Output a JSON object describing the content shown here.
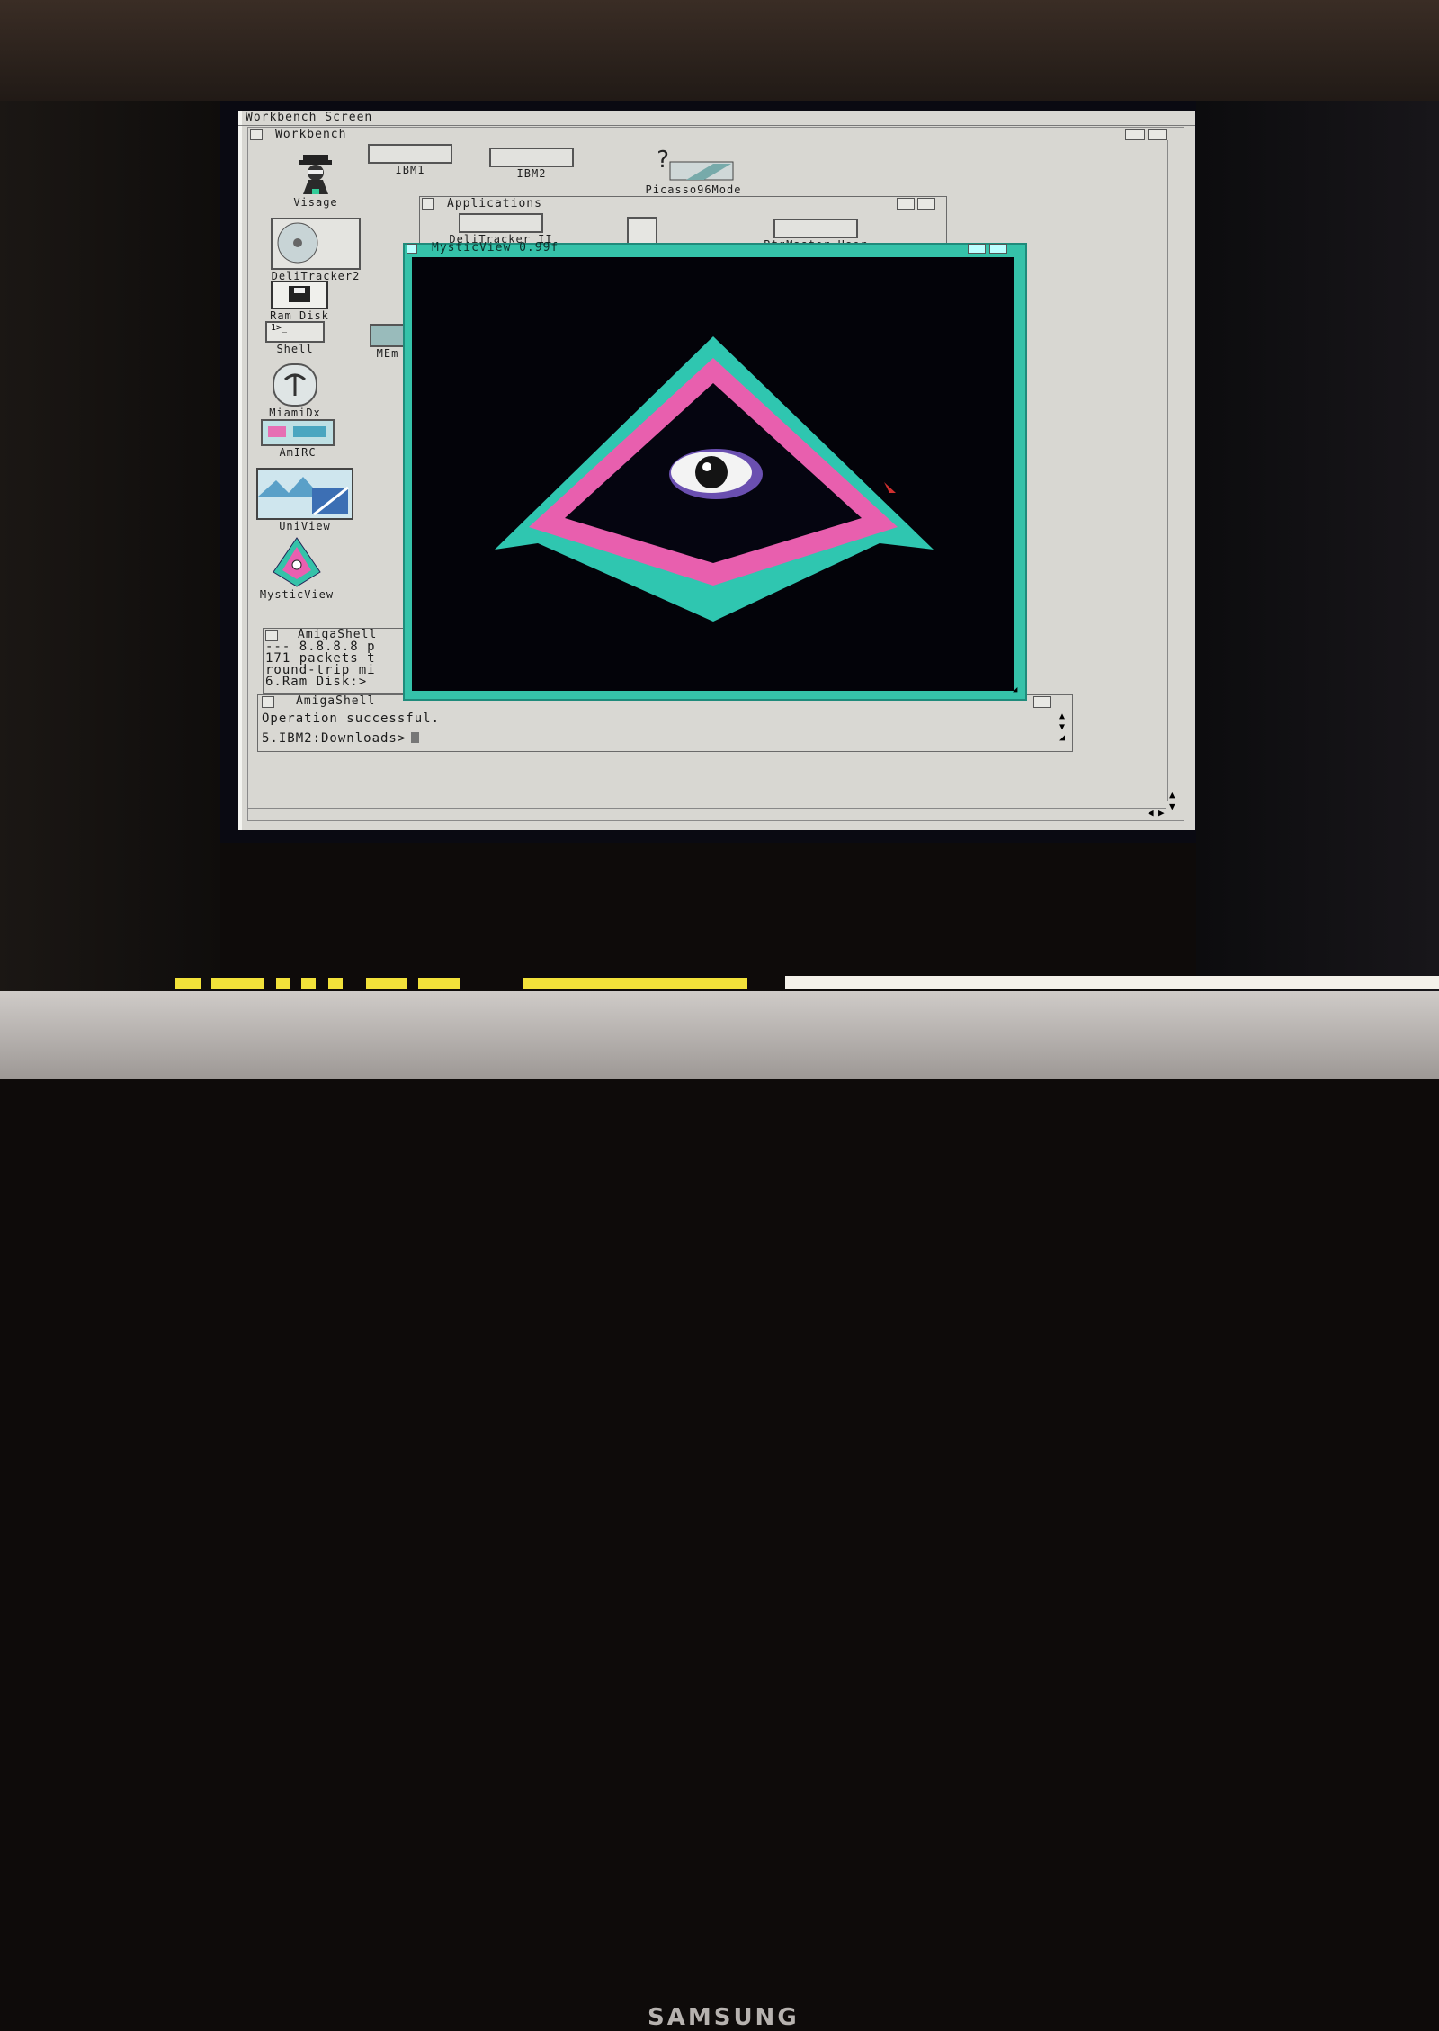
{
  "monitor": {
    "brand": "SAMSUNG"
  },
  "screen_title": "Workbench Screen",
  "workbench": {
    "title": "Workbench",
    "icons": [
      {
        "label": "Visage",
        "icon": "visage-icon"
      },
      {
        "label": "IBM1",
        "icon": "drive-icon"
      },
      {
        "label": "IBM2",
        "icon": "drive-icon"
      },
      {
        "label": "Picasso96Mode",
        "icon": "picasso-icon"
      },
      {
        "label": "DeliTracker2",
        "icon": "cd-icon"
      },
      {
        "label": "Ram Disk",
        "icon": "ram-disk-icon"
      },
      {
        "label": "Shell",
        "icon": "shell-icon"
      },
      {
        "label": "MEm",
        "icon": "mem-icon"
      },
      {
        "label": "MiamiDx",
        "icon": "miami-icon"
      },
      {
        "label": "AmIRC",
        "icon": "amirc-icon"
      },
      {
        "label": "UniView",
        "icon": "uniview-icon"
      },
      {
        "label": "MysticView",
        "icon": "mysticview-icon"
      }
    ]
  },
  "applications": {
    "title": "Applications",
    "icons": [
      {
        "label": "DeliTracker II",
        "icon": "drive-icon"
      },
      {
        "label": "RtgMaster_User",
        "icon": "drive-icon"
      }
    ]
  },
  "mysticview": {
    "title": "MysticView 0.99f",
    "accent": "#35c2a9"
  },
  "shell1": {
    "title": "AmigaShell",
    "lines": [
      "--- 8.8.8.8 p",
      "171 packets t",
      "round-trip mi",
      "6.Ram Disk:>"
    ]
  },
  "shell2": {
    "title": "AmigaShell",
    "lines": [
      "Operation successful.",
      "5.IBM2:Downloads>"
    ]
  }
}
